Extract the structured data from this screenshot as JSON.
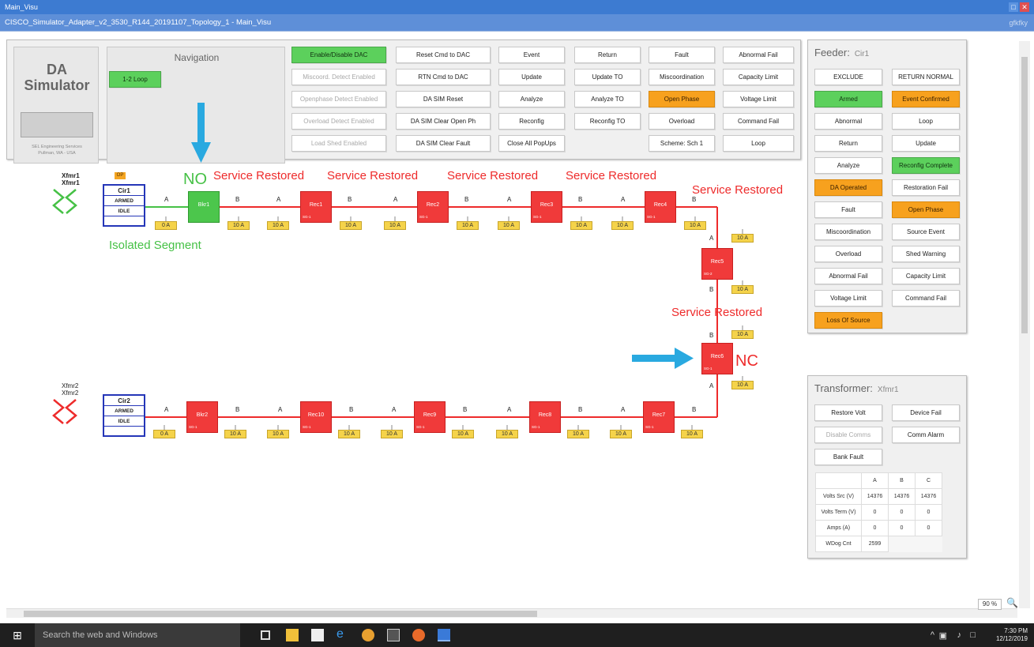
{
  "window": {
    "title": "Main_Visu",
    "doc_title": "CISCO_Simulator_Adapter_v2_3530_R144_20191107_Topology_1 - Main_Visu",
    "right_text": "gfkfky"
  },
  "header_panel": {
    "da_title_1": "DA",
    "da_title_2": "Simulator",
    "credit_1": "SEL Engineering Services",
    "credit_2": "Pullman, WA - USA",
    "navigation_title": "Navigation",
    "loop_button": "1-2 Loop"
  },
  "control_buttons": {
    "col1": [
      {
        "label": "Enable/Disable DAC",
        "style": "green"
      },
      {
        "label": "Miscoord. Detect Enabled",
        "style": "dim"
      },
      {
        "label": "Openphase Detect Enabled",
        "style": "dim"
      },
      {
        "label": "Overload Detect Enabled",
        "style": "dim"
      },
      {
        "label": "Load Shed Enabled",
        "style": "dim"
      }
    ],
    "col2": [
      {
        "label": "Reset Cmd to DAC",
        "style": ""
      },
      {
        "label": "RTN Cmd to DAC",
        "style": ""
      },
      {
        "label": "DA SIM Reset",
        "style": ""
      },
      {
        "label": "DA SIM Clear Open Ph",
        "style": ""
      },
      {
        "label": "DA SIM Clear Fault",
        "style": ""
      }
    ],
    "col3": [
      {
        "label": "Event",
        "style": ""
      },
      {
        "label": "Update",
        "style": ""
      },
      {
        "label": "Analyze",
        "style": ""
      },
      {
        "label": "Reconfig",
        "style": ""
      },
      {
        "label": "Close All PopUps",
        "style": ""
      }
    ],
    "col4": [
      {
        "label": "Return",
        "style": ""
      },
      {
        "label": "Update TO",
        "style": ""
      },
      {
        "label": "Analyze TO",
        "style": ""
      },
      {
        "label": "Reconfig TO",
        "style": ""
      }
    ],
    "col5": [
      {
        "label": "Fault",
        "style": ""
      },
      {
        "label": "Miscoordination",
        "style": ""
      },
      {
        "label": "Open Phase",
        "style": "orange"
      },
      {
        "label": "Overload",
        "style": ""
      },
      {
        "label": "Scheme: Sch 1",
        "style": ""
      }
    ],
    "col6": [
      {
        "label": "Abnormal Fail",
        "style": ""
      },
      {
        "label": "Capacity Limit",
        "style": ""
      },
      {
        "label": "Voltage Limit",
        "style": ""
      },
      {
        "label": "Command Fail",
        "style": ""
      },
      {
        "label": "Loop",
        "style": ""
      }
    ]
  },
  "feeder": {
    "title": "Feeder:",
    "name": "Cir1",
    "left": [
      {
        "label": "EXCLUDE",
        "style": ""
      },
      {
        "label": "Armed",
        "style": "green"
      },
      {
        "label": "Abnormal",
        "style": ""
      },
      {
        "label": "Return",
        "style": ""
      },
      {
        "label": "Analyze",
        "style": ""
      },
      {
        "label": "DA Operated",
        "style": "orange"
      },
      {
        "label": "Fault",
        "style": ""
      },
      {
        "label": "Miscoordination",
        "style": ""
      },
      {
        "label": "Overload",
        "style": ""
      },
      {
        "label": "Abnormal Fail",
        "style": ""
      },
      {
        "label": "Voltage Limit",
        "style": ""
      },
      {
        "label": "Loss Of Source",
        "style": "orange"
      }
    ],
    "right": [
      {
        "label": "RETURN NORMAL",
        "style": ""
      },
      {
        "label": "Event Confirmed",
        "style": "orange"
      },
      {
        "label": "Loop",
        "style": ""
      },
      {
        "label": "Update",
        "style": ""
      },
      {
        "label": "Reconfig Complete",
        "style": "green"
      },
      {
        "label": "Restoration Fail",
        "style": ""
      },
      {
        "label": "Open Phase",
        "style": "orange"
      },
      {
        "label": "Source Event",
        "style": ""
      },
      {
        "label": "Shed Warning",
        "style": ""
      },
      {
        "label": "Capacity Limit",
        "style": ""
      },
      {
        "label": "Command Fail",
        "style": ""
      }
    ]
  },
  "transformer": {
    "title": "Transformer:",
    "name": "Xfmr1",
    "buttons": [
      {
        "label": "Restore Volt",
        "style": ""
      },
      {
        "label": "Device Fail",
        "style": ""
      },
      {
        "label": "Disable Comms",
        "style": "dim"
      },
      {
        "label": "Comm Alarm",
        "style": ""
      },
      {
        "label": "Bank Fault",
        "style": ""
      }
    ],
    "table": {
      "headers": [
        "",
        "A",
        "B",
        "C"
      ],
      "rows": [
        [
          "Volts Src (V)",
          "14376",
          "14376",
          "14376"
        ],
        [
          "Volts Term (V)",
          "0",
          "0",
          "0"
        ],
        [
          "Amps (A)",
          "0",
          "0",
          "0"
        ]
      ],
      "wdog_label": "WDog Cnt",
      "wdog_value": "2599"
    }
  },
  "diagram": {
    "xfmr1_a": "Xfmr1",
    "xfmr1_b": "Xfmr1",
    "xfmr2_a": "Xfmr2",
    "xfmr2_b": "Xfmr2",
    "op_badge": "OP",
    "ctrl1": [
      "Cir1",
      "ARMED",
      "IDLE"
    ],
    "ctrl2": [
      "Cir2",
      "ARMED",
      "IDLE"
    ],
    "no_label": "NO",
    "nc_label": "NC",
    "isolated": "Isolated Segment",
    "restored": "Service Restored",
    "sg": "SG-1",
    "sg2": "SG-2",
    "devices_top": [
      "Bkr1",
      "Rec1",
      "Rec2",
      "Rec3",
      "Rec4"
    ],
    "devices_right": [
      "Rec5",
      "Rec6"
    ],
    "devices_bottom": [
      "Bkr2",
      "Rec10",
      "Rec9",
      "Rec8",
      "Rec7"
    ],
    "phase_a": "A",
    "phase_b": "B",
    "amp_zero": "0 A",
    "amp_ten": "10 A",
    "colors": {
      "energized": "#ee2b2b",
      "isolated": "#46c146",
      "arrow": "#29a9e0",
      "controller": "#2536b8"
    }
  },
  "statusbar": {
    "zoom": "90 %"
  },
  "taskbar": {
    "search_placeholder": "Search the web and Windows",
    "time": "7:30 PM",
    "date": "12/12/2019"
  }
}
